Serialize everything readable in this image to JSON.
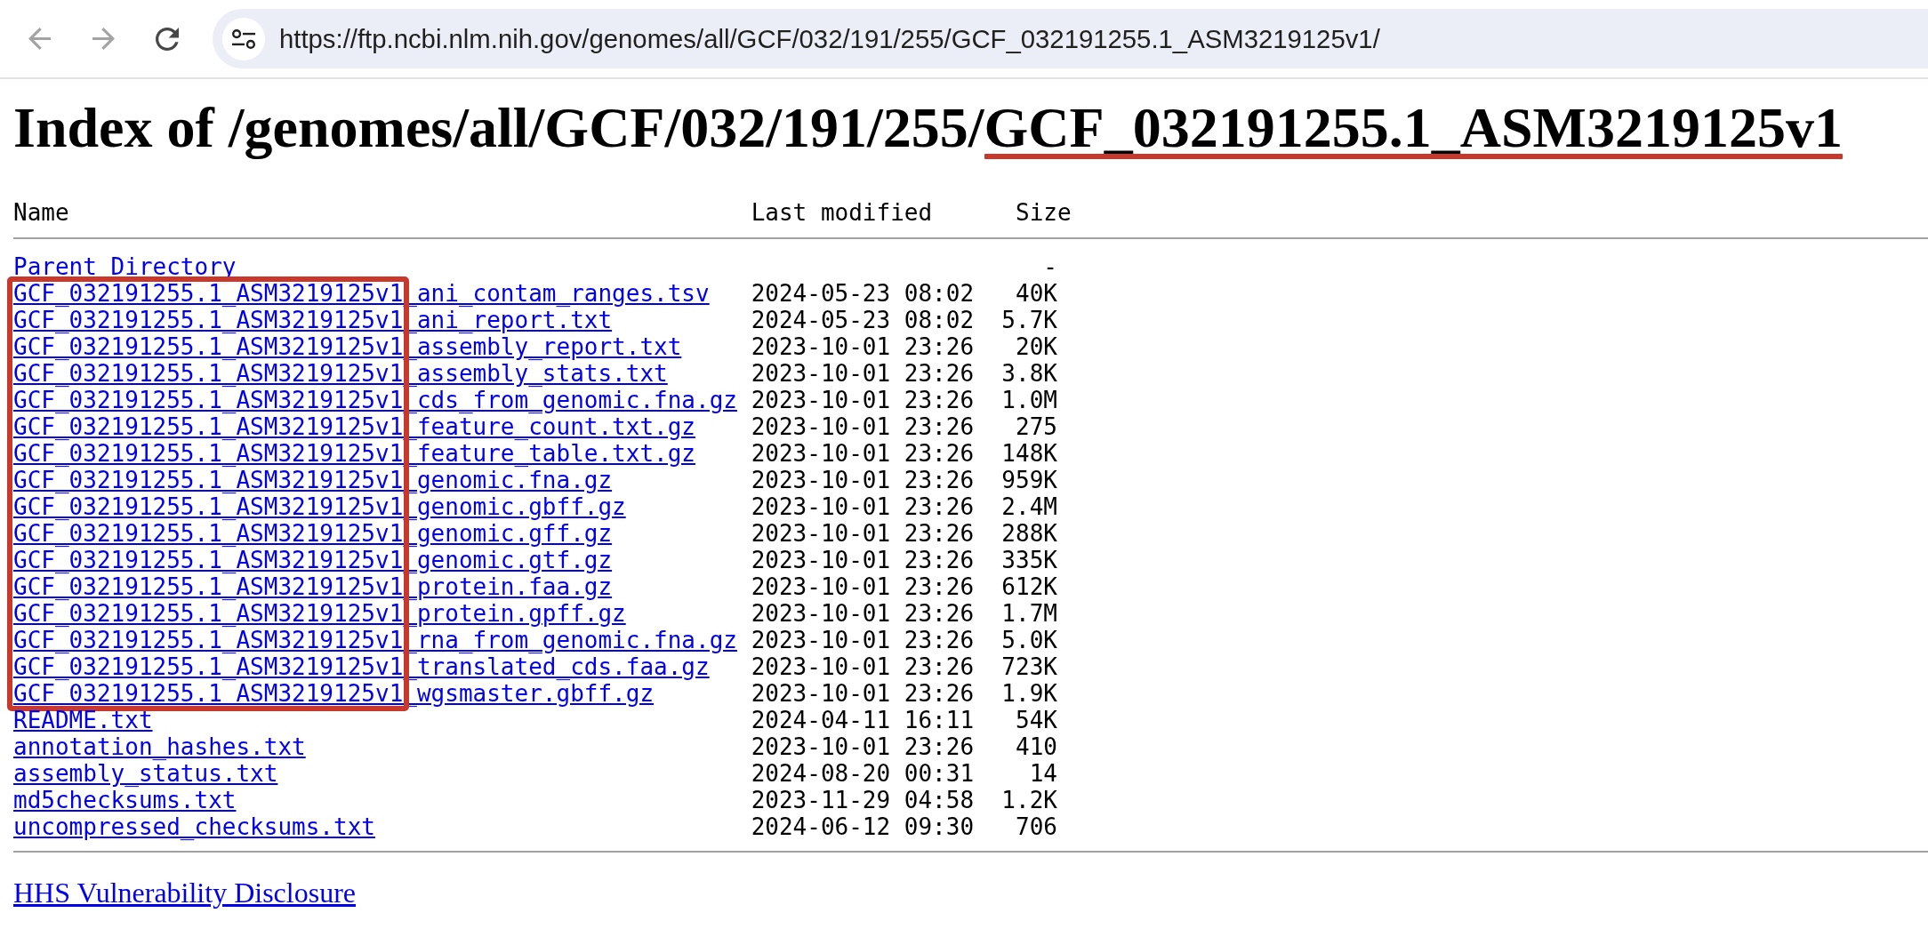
{
  "browser": {
    "nav_buttons": [
      {
        "kind": "back",
        "disabled": true
      },
      {
        "kind": "forward",
        "disabled": true
      },
      {
        "kind": "reload",
        "disabled": false
      }
    ],
    "url": "https://ftp.ncbi.nlm.nih.gov/genomes/all/GCF/032/191/255/GCF_032191255.1_ASM3219125v1/"
  },
  "heading": {
    "parts": [
      {
        "text": "Index of /genomes/all/GCF/032/191/255/",
        "underlined": false
      },
      {
        "text": "GCF_032191255.1_ASM3219125v1",
        "underlined": true
      }
    ]
  },
  "listing": {
    "columns": [
      "Name",
      "Last modified",
      "Size"
    ],
    "sections": [
      {
        "boxed": false,
        "rows": [
          {
            "name": "Parent Directory",
            "size": "-"
          }
        ]
      },
      {
        "boxed": true,
        "rows": [
          {
            "name": "GCF_032191255.1_ASM3219125v1_ani_contam_ranges.tsv",
            "modified": "2024-05-23 08:02",
            "size": "40K"
          },
          {
            "name": "GCF_032191255.1_ASM3219125v1_ani_report.txt",
            "modified": "2024-05-23 08:02",
            "size": "5.7K"
          },
          {
            "name": "GCF_032191255.1_ASM3219125v1_assembly_report.txt",
            "modified": "2023-10-01 23:26",
            "size": "20K"
          },
          {
            "name": "GCF_032191255.1_ASM3219125v1_assembly_stats.txt",
            "modified": "2023-10-01 23:26",
            "size": "3.8K"
          },
          {
            "name": "GCF_032191255.1_ASM3219125v1_cds_from_genomic.fna.gz",
            "modified": "2023-10-01 23:26",
            "size": "1.0M"
          },
          {
            "name": "GCF_032191255.1_ASM3219125v1_feature_count.txt.gz",
            "modified": "2023-10-01 23:26",
            "size": "275"
          },
          {
            "name": "GCF_032191255.1_ASM3219125v1_feature_table.txt.gz",
            "modified": "2023-10-01 23:26",
            "size": "148K"
          },
          {
            "name": "GCF_032191255.1_ASM3219125v1_genomic.fna.gz",
            "modified": "2023-10-01 23:26",
            "size": "959K"
          },
          {
            "name": "GCF_032191255.1_ASM3219125v1_genomic.gbff.gz",
            "modified": "2023-10-01 23:26",
            "size": "2.4M"
          },
          {
            "name": "GCF_032191255.1_ASM3219125v1_genomic.gff.gz",
            "modified": "2023-10-01 23:26",
            "size": "288K"
          },
          {
            "name": "GCF_032191255.1_ASM3219125v1_genomic.gtf.gz",
            "modified": "2023-10-01 23:26",
            "size": "335K"
          },
          {
            "name": "GCF_032191255.1_ASM3219125v1_protein.faa.gz",
            "modified": "2023-10-01 23:26",
            "size": "612K"
          },
          {
            "name": "GCF_032191255.1_ASM3219125v1_protein.gpff.gz",
            "modified": "2023-10-01 23:26",
            "size": "1.7M"
          },
          {
            "name": "GCF_032191255.1_ASM3219125v1_rna_from_genomic.fna.gz",
            "modified": "2023-10-01 23:26",
            "size": "5.0K"
          },
          {
            "name": "GCF_032191255.1_ASM3219125v1_translated_cds.faa.gz",
            "modified": "2023-10-01 23:26",
            "size": "723K"
          },
          {
            "name": "GCF_032191255.1_ASM3219125v1_wgsmaster.gbff.gz",
            "modified": "2023-10-01 23:26",
            "size": "1.9K"
          }
        ]
      },
      {
        "boxed": false,
        "rows": [
          {
            "name": "README.txt",
            "modified": "2024-04-11 16:11",
            "size": "54K"
          },
          {
            "name": "annotation_hashes.txt",
            "modified": "2023-10-01 23:26",
            "size": "410"
          },
          {
            "name": "assembly_status.txt",
            "modified": "2024-08-20 00:31",
            "size": "14"
          },
          {
            "name": "md5checksums.txt",
            "modified": "2023-11-29 04:58",
            "size": "1.2K"
          },
          {
            "name": "uncompressed_checksums.txt",
            "modified": "2024-06-12 09:30",
            "size": "706"
          }
        ]
      }
    ]
  },
  "footer": {
    "link": "HHS Vulnerability Disclosure"
  }
}
